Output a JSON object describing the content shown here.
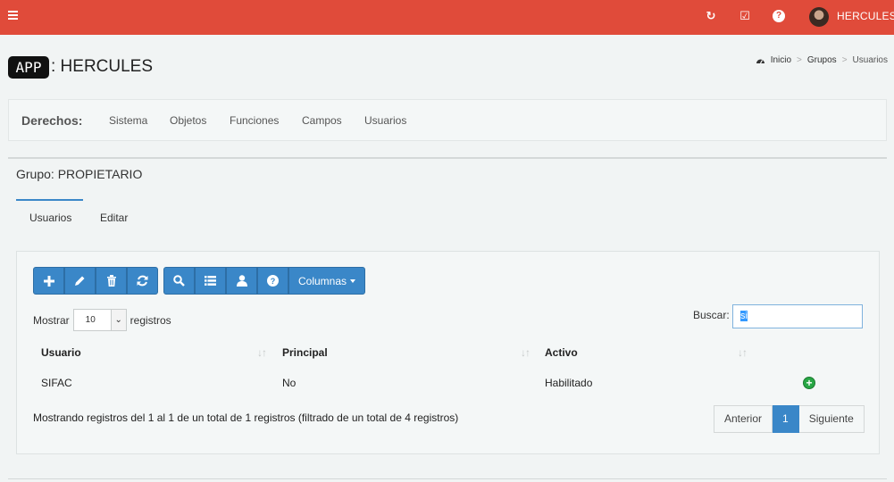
{
  "topbar": {
    "refresh_icon": "↻",
    "tasks_icon": "☑",
    "help_icon": "?",
    "username": "HERCULES"
  },
  "header": {
    "app_badge": "APP",
    "title": ": HERCULES"
  },
  "breadcrumb": {
    "home_label": "Inicio",
    "groups_label": "Grupos",
    "current_label": "Usuarios"
  },
  "derechos": {
    "label": "Derechos:",
    "items": [
      "Sistema",
      "Objetos",
      "Funciones",
      "Campos",
      "Usuarios"
    ]
  },
  "group": {
    "title": "Grupo: PROPIETARIO",
    "tabs": [
      "Usuarios",
      "Editar"
    ]
  },
  "toolbar": {
    "columns_label": "Columnas"
  },
  "table_controls": {
    "show_label": "Mostrar",
    "page_size": "10",
    "records_label": "registros",
    "search_label": "Buscar:",
    "search_value": "si"
  },
  "table": {
    "headers": [
      "Usuario",
      "Principal",
      "Activo"
    ],
    "rows": [
      {
        "usuario": "SIFAC",
        "principal": "No",
        "activo": "Habilitado"
      }
    ]
  },
  "footer": {
    "info": "Mostrando registros del 1 al 1 de un total de 1 registros (filtrado de un total de 4 registros)",
    "prev_label": "Anterior",
    "page_number": "1",
    "next_label": "Siguiente"
  },
  "colors": {
    "topbar": "#e04b3a",
    "primary": "#3a87c8",
    "success": "#28a745"
  }
}
